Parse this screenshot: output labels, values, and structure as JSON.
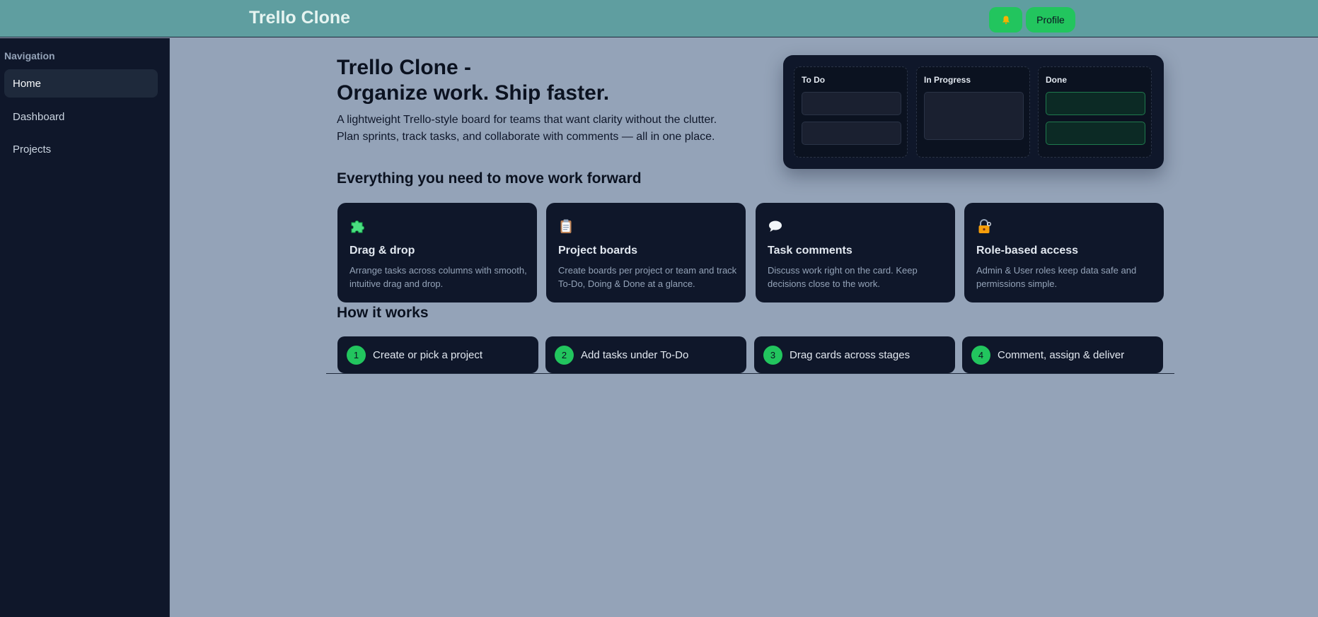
{
  "header": {
    "title": "Trello Clone",
    "profile_label": "Profile",
    "notification_icon": "bell-icon"
  },
  "sidebar": {
    "heading": "Navigation",
    "items": [
      {
        "label": "Home",
        "active": true
      },
      {
        "label": "Dashboard",
        "active": false
      },
      {
        "label": "Projects",
        "active": false
      }
    ]
  },
  "hero": {
    "title_line1": "Trello Clone -",
    "title_line2": "Organize work. Ship faster.",
    "desc_line1": "A lightweight Trello-style board for teams that want clarity without the clutter.",
    "desc_line2": "Plan sprints, track tasks, and collaborate with comments — all in one place."
  },
  "board_preview": {
    "columns": [
      {
        "title": "To Do"
      },
      {
        "title": "In Progress"
      },
      {
        "title": "Done"
      }
    ]
  },
  "features": {
    "heading": "Everything you need to move work forward",
    "items": [
      {
        "icon": "puzzle-icon",
        "title": "Drag & drop",
        "desc": "Arrange tasks across columns with smooth, intuitive drag and drop."
      },
      {
        "icon": "clipboard-icon",
        "title": "Project boards",
        "desc": "Create boards per project or team and track To-Do, Doing & Done at a glance."
      },
      {
        "icon": "speech-bubble-icon",
        "title": "Task comments",
        "desc": "Discuss work right on the card. Keep decisions close to the work."
      },
      {
        "icon": "lock-key-icon",
        "title": "Role-based access",
        "desc": "Admin & User roles keep data safe and permissions simple."
      }
    ]
  },
  "how_it_works": {
    "heading": "How it works",
    "steps": [
      {
        "num": "1",
        "label": "Create or pick a project"
      },
      {
        "num": "2",
        "label": "Add tasks under To-Do"
      },
      {
        "num": "3",
        "label": "Drag cards across stages"
      },
      {
        "num": "4",
        "label": "Comment, assign & deliver"
      }
    ]
  },
  "colors": {
    "header_bg": "#5f9ea0",
    "sidebar_bg": "#0f172a",
    "page_bg": "#94a3b8",
    "accent": "#22c55e"
  }
}
